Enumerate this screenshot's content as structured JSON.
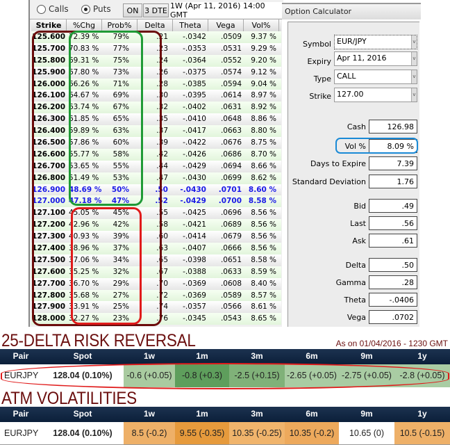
{
  "toolbar": {
    "calls_label": "Calls",
    "puts_label": "Puts",
    "selected": "Puts",
    "on_label": "ON",
    "dte_label": "3 DTE",
    "expiry_label": "1W (Apr 11, 2016) 14:00 GMT"
  },
  "table": {
    "headers": [
      "Strike",
      "%Chg",
      "Prob%",
      "Delta",
      "Theta",
      "Vega",
      "Vol%"
    ],
    "rows": [
      [
        "125.600",
        "72.39 %",
        "79%",
        ".21",
        "-.0342",
        ".0509",
        "9.37 %"
      ],
      [
        "125.700",
        "70.83 %",
        "77%",
        ".23",
        "-.0353",
        ".0531",
        "9.29 %"
      ],
      [
        "125.800",
        "69.31 %",
        "75%",
        ".24",
        "-.0364",
        ".0552",
        "9.20 %"
      ],
      [
        "125.900",
        "67.80 %",
        "73%",
        ".26",
        "-.0375",
        ".0574",
        "9.12 %"
      ],
      [
        "126.000",
        "66.26 %",
        "71%",
        ".28",
        "-.0385",
        ".0594",
        "9.04 %"
      ],
      [
        "126.100",
        "64.67 %",
        "69%",
        ".30",
        "-.0395",
        ".0614",
        "8.97 %"
      ],
      [
        "126.200",
        "63.74 %",
        "67%",
        ".32",
        "-.0402",
        ".0631",
        "8.92 %"
      ],
      [
        "126.300",
        "61.85 %",
        "65%",
        ".35",
        "-.0410",
        ".0648",
        "8.86 %"
      ],
      [
        "126.400",
        "59.89 %",
        "63%",
        ".37",
        "-.0417",
        ".0663",
        "8.80 %"
      ],
      [
        "126.500",
        "57.86 %",
        "60%",
        ".39",
        "-.0422",
        ".0676",
        "8.75 %"
      ],
      [
        "126.600",
        "55.77 %",
        "58%",
        ".42",
        "-.0426",
        ".0686",
        "8.70 %"
      ],
      [
        "126.700",
        "53.65 %",
        "55%",
        ".44",
        "-.0429",
        ".0694",
        "8.66 %"
      ],
      [
        "126.800",
        "51.49 %",
        "53%",
        ".47",
        "-.0430",
        ".0699",
        "8.62 %"
      ],
      [
        "126.900",
        "48.69 %",
        "50%",
        ".50",
        "-.0430",
        ".0701",
        "8.60 %"
      ],
      [
        "127.000",
        "47.18 %",
        "47%",
        ".52",
        "-.0429",
        ".0700",
        "8.58 %"
      ],
      [
        "127.100",
        "45.05 %",
        "45%",
        ".55",
        "-.0425",
        ".0696",
        "8.56 %"
      ],
      [
        "127.200",
        "42.96 %",
        "42%",
        ".58",
        "-.0421",
        ".0689",
        "8.56 %"
      ],
      [
        "127.300",
        "40.93 %",
        "39%",
        ".60",
        "-.0414",
        ".0679",
        "8.56 %"
      ],
      [
        "127.400",
        "38.96 %",
        "37%",
        ".63",
        "-.0407",
        ".0666",
        "8.56 %"
      ],
      [
        "127.500",
        "37.06 %",
        "34%",
        ".65",
        "-.0398",
        ".0651",
        "8.58 %"
      ],
      [
        "127.600",
        "35.25 %",
        "32%",
        ".67",
        "-.0388",
        ".0633",
        "8.59 %"
      ],
      [
        "127.700",
        "36.70 %",
        "29%",
        ".70",
        "-.0369",
        ".0608",
        "8.40 %"
      ],
      [
        "127.800",
        "35.68 %",
        "27%",
        ".72",
        "-.0369",
        ".0589",
        "8.57 %"
      ],
      [
        "127.900",
        "33.91 %",
        "25%",
        ".74",
        "-.0357",
        ".0566",
        "8.61 %"
      ],
      [
        "128.000",
        "32.27 %",
        "23%",
        ".76",
        "-.0345",
        ".0543",
        "8.65 %"
      ]
    ],
    "highlighted_strikes": [
      "126.900",
      "127.000"
    ]
  },
  "calculator": {
    "title": "Option Calculator",
    "symbol_label": "Symbol",
    "symbol": "EUR/JPY",
    "expiry_label": "Expiry",
    "expiry": "Apr 11, 2016",
    "type_label": "Type",
    "type": "CALL",
    "strike_label": "Strike",
    "strike": "127.00",
    "fields": [
      [
        "Cash",
        "126.98"
      ],
      [
        "Vol %",
        "8.09 %"
      ],
      [
        "Days to Expire",
        "7.39"
      ],
      [
        "Standard Deviation",
        "1.76"
      ],
      [
        "Bid",
        ".49"
      ],
      [
        "Last",
        ".56"
      ],
      [
        "Ask",
        ".61"
      ],
      [
        "Delta",
        ".50"
      ],
      [
        "Gamma",
        ".28"
      ],
      [
        "Theta",
        "-.0406"
      ],
      [
        "Vega",
        ".0702"
      ]
    ]
  },
  "risk_reversal": {
    "title": "25-DELTA RISK REVERSAL",
    "as_on": "As on 01/04/2016 - 1230 GMT",
    "headers": [
      "Pair",
      "Spot",
      "1w",
      "1m",
      "3m",
      "6m",
      "9m",
      "1y"
    ],
    "row": [
      "EURJPY",
      "128.04 (0.10%)",
      "-0.6 (+0.05)",
      "-0.8 (+0.3)",
      "-2.5 (+0.15)",
      "-2.65 (+0.05)",
      "-2.75 (+0.05)",
      "-2.8 (+0.05)"
    ],
    "colors": [
      "#ffffff",
      "#ffffff",
      "#a9cba0",
      "#5e9e5c",
      "#80b179",
      "#a9cca3",
      "#a9cca3",
      "#a9cca3"
    ]
  },
  "atm_vol": {
    "title": "ATM VOLATILITIES",
    "headers": [
      "Pair",
      "Spot",
      "1w",
      "1m",
      "3m",
      "6m",
      "9m",
      "1y"
    ],
    "row": [
      "EURJPY",
      "128.04 (0.10%)",
      "8.5 (-0.2)",
      "9.55 (-0.35)",
      "10.35 (-0.25)",
      "10.35 (-0.2)",
      "10.65 (0)",
      "10.5 (-0.15)"
    ],
    "colors": [
      "#ffffff",
      "#ffffff",
      "#eeb068",
      "#e69a3c",
      "#f0b46c",
      "#eda95c",
      "#ffffff",
      "#eeb068"
    ]
  }
}
